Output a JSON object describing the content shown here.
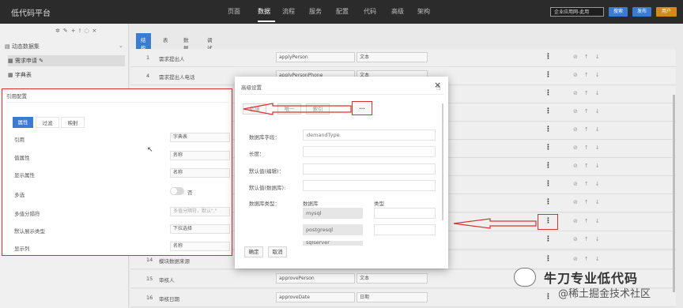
{
  "app": {
    "title": "低代码平台"
  },
  "nav": {
    "items": [
      "页面",
      "数据",
      "流程",
      "服务",
      "配置",
      "代码",
      "高级",
      "架构"
    ],
    "active_index": 1
  },
  "toolbar": {
    "project": "企业应用网-此用",
    "btn_search": "搜索",
    "btn_publish": "发布",
    "btn_user": "用户"
  },
  "sidebar": {
    "group": "动态数据集",
    "items": [
      {
        "label": "需求申请"
      },
      {
        "label": "字典表"
      }
    ]
  },
  "tabs": [
    "结构",
    "表",
    "数据",
    "调试"
  ],
  "rows": [
    {
      "no": "1",
      "name": "需求提出人",
      "field": "applyPerson",
      "type": "文本"
    },
    {
      "no": "4",
      "name": "需求提出人电话",
      "field": "applyPersonPhone",
      "type": "文本"
    },
    {
      "no": "14",
      "name": "模块数据来源",
      "field": "",
      "type": ""
    },
    {
      "no": "15",
      "name": "审核人",
      "field": "approvePerson",
      "type": "文本"
    },
    {
      "no": "16",
      "name": "审核日期",
      "field": "approveDate",
      "type": "日期"
    }
  ],
  "ref_panel": {
    "title": "引用配置",
    "tabs": [
      "属性",
      "过滤",
      "映射"
    ],
    "fields": [
      {
        "label": "引用",
        "value": "字典表"
      },
      {
        "label": "值属性",
        "value": "名称"
      },
      {
        "label": "显示属性",
        "value": "名称"
      },
      {
        "label": "多选",
        "value": "否"
      },
      {
        "label": "多值分隔符",
        "value": "",
        "placeholder": "多值分隔符，默认\",\""
      },
      {
        "label": "默认展示类型",
        "value": "下拉选择"
      },
      {
        "label": "显示列",
        "value": "名称"
      }
    ]
  },
  "modal": {
    "title": "高级设置",
    "close": "×",
    "seg_buttons": [
      "必填",
      "唯一",
      "索引",
      "..."
    ],
    "fields": [
      {
        "label": "数据库字段：",
        "value": "demandType"
      },
      {
        "label": "长度：",
        "value": ""
      },
      {
        "label": "默认值(编辑)：",
        "value": ""
      },
      {
        "label": "默认值(数据库):",
        "value": ""
      }
    ],
    "db_type_label": "数据库类型：",
    "db_col_header": "数据库",
    "type_col_header": "类型",
    "databases": [
      "mysql",
      "postgresql",
      "sqlserver"
    ],
    "ok": "确定",
    "cancel": "取消"
  },
  "watermark": {
    "line1": "牛刀专业低代码",
    "line2": "@稀土掘金技术社区"
  },
  "colors": {
    "topbar": "#2b2b2b",
    "accent": "#3b7bd1",
    "highlight": "#d93030"
  }
}
